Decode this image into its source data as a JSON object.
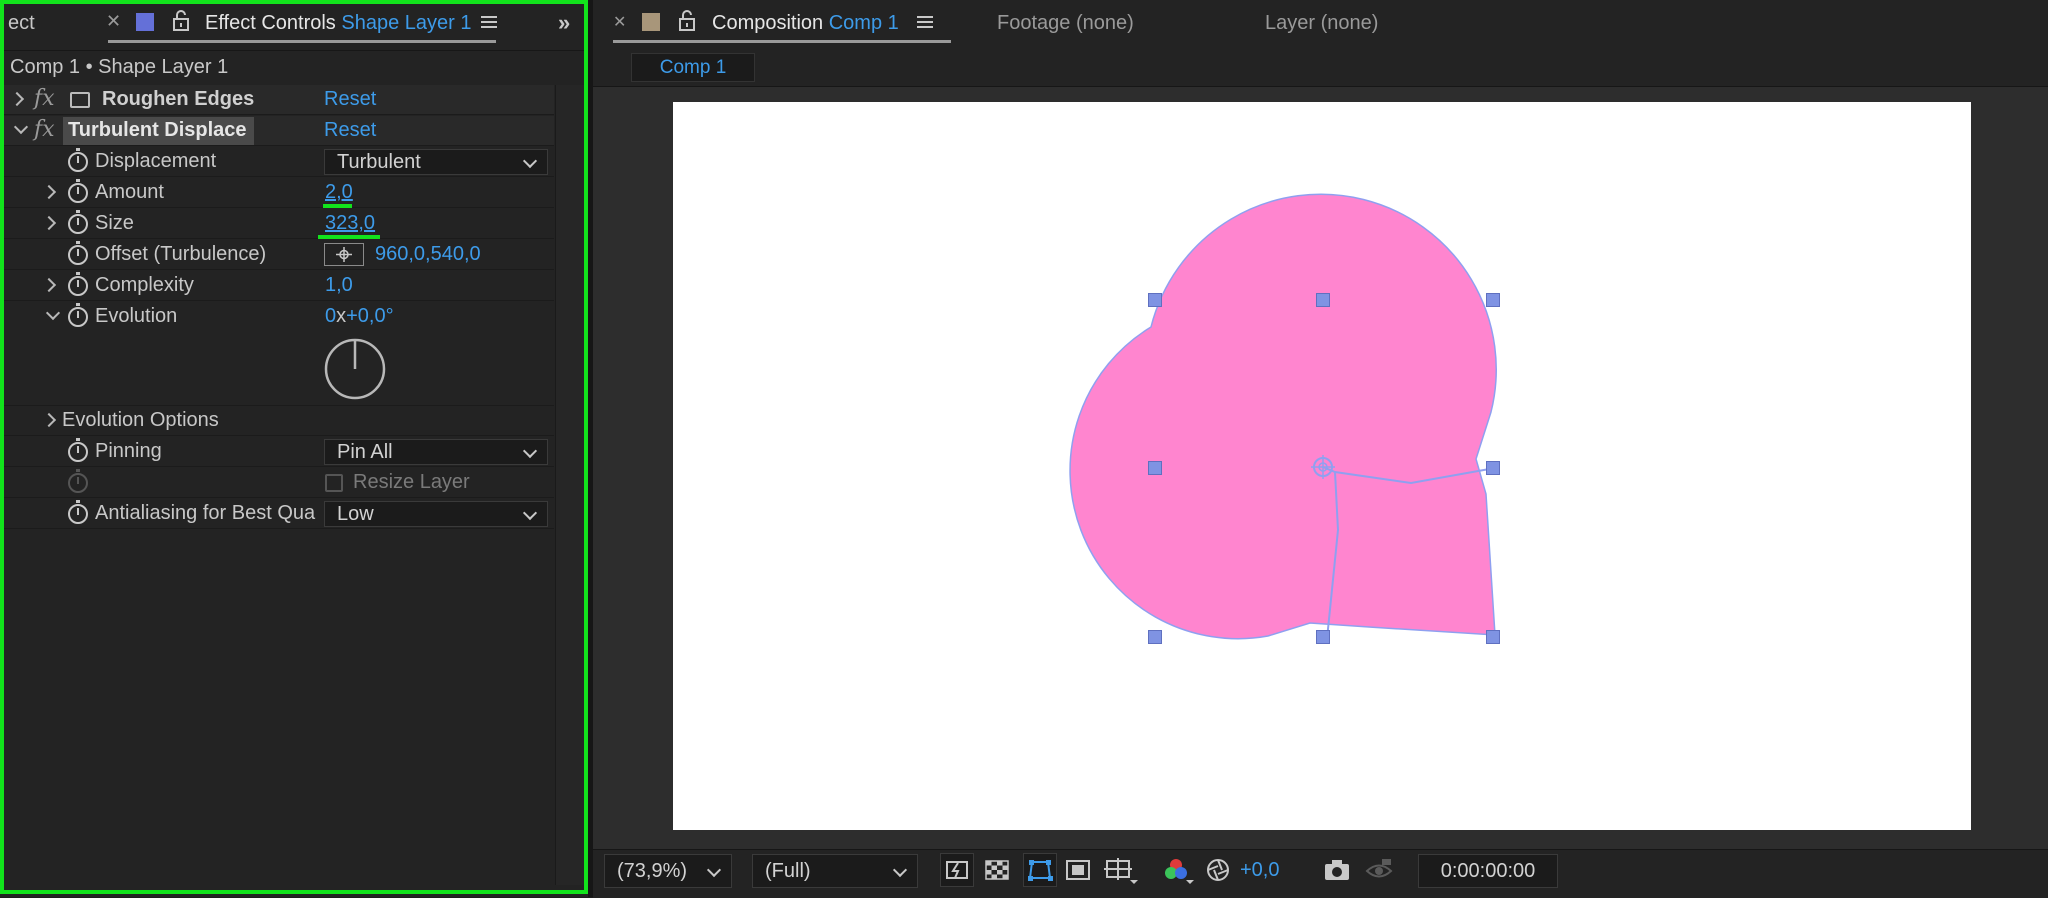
{
  "left_panel": {
    "tabs": {
      "truncated_tab": "ect",
      "effect_controls_label": "Effect Controls",
      "effect_controls_layer": "Shape Layer 1"
    },
    "breadcrumb": "Comp 1 • Shape Layer 1",
    "effects": [
      {
        "name": "Roughen Edges",
        "reset": "Reset"
      },
      {
        "name": "Turbulent Displace",
        "reset": "Reset"
      }
    ],
    "properties": {
      "displacement": {
        "label": "Displacement",
        "value": "Turbulent"
      },
      "amount": {
        "label": "Amount",
        "value": "2,0"
      },
      "size": {
        "label": "Size",
        "value": "323,0"
      },
      "offset": {
        "label": "Offset (Turbulence)",
        "value": "960,0,540,0"
      },
      "complexity": {
        "label": "Complexity",
        "value": "1,0"
      },
      "evolution": {
        "label": "Evolution",
        "value_revs": "0",
        "value_x": "x",
        "value_deg": "+0,0°"
      },
      "evolution_options": {
        "label": "Evolution Options"
      },
      "pinning": {
        "label": "Pinning",
        "value": "Pin All"
      },
      "resize_layer": {
        "label": "Resize Layer",
        "checked": false
      },
      "antialiasing": {
        "label": "Antialiasing for Best Qua",
        "value": "Low"
      }
    },
    "highlight_color": "#12e31c"
  },
  "right_panel": {
    "tabs": {
      "composition_label": "Composition",
      "composition_name": "Comp 1",
      "footage": "Footage (none)",
      "layer": "Layer (none)"
    },
    "sub_tab": "Comp 1",
    "bottom_bar": {
      "zoom": "(73,9%)",
      "resolution": "(Full)",
      "exposure": "+0,0",
      "timecode": "0:00:00:00"
    },
    "shape_fill_color": "#ff85cf",
    "handle_color": "#7f93e3"
  }
}
